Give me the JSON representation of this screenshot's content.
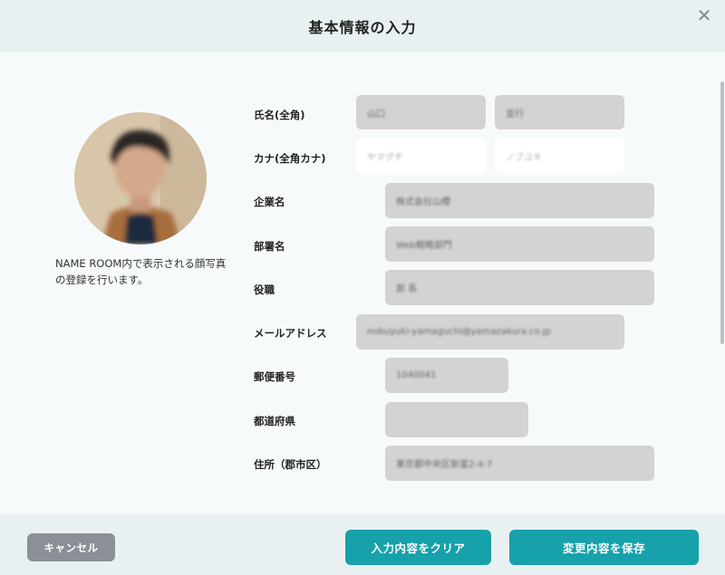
{
  "dialog": {
    "title": "基本情報の入力",
    "close_icon": "close-icon"
  },
  "profile": {
    "photo_icon": "person-photo",
    "note": "NAME ROOM内で表示される顔写真の登録を行います。"
  },
  "form": {
    "name_label": "氏名(全角)",
    "last_name": "山口",
    "first_name": "宣行",
    "kana_label": "カナ(全角カナ)",
    "last_kana": "ヤマグチ",
    "first_kana": "ノブユキ",
    "company_label": "企業名",
    "company": "株式会社山櫻",
    "department_label": "部署名",
    "department": "Web戦略部門",
    "position_label": "役職",
    "position": "部 長",
    "email_label": "メールアドレス",
    "email": "nobuyuki-yamaguchi@yamazakura.co.jp",
    "postal_label": "郵便番号",
    "postal": "1040041",
    "prefecture_label": "都道府県",
    "prefecture": "",
    "address_label": "住所（郡市区）",
    "address": "東京都中央区新富2-4-7"
  },
  "footer": {
    "cancel_label": "キャンセル",
    "clear_label": "入力内容をクリア",
    "save_label": "変更内容を保存"
  },
  "colors": {
    "primary": "#16a1ab",
    "cancel": "#8a9095",
    "header_bg": "#e9f0f2"
  }
}
